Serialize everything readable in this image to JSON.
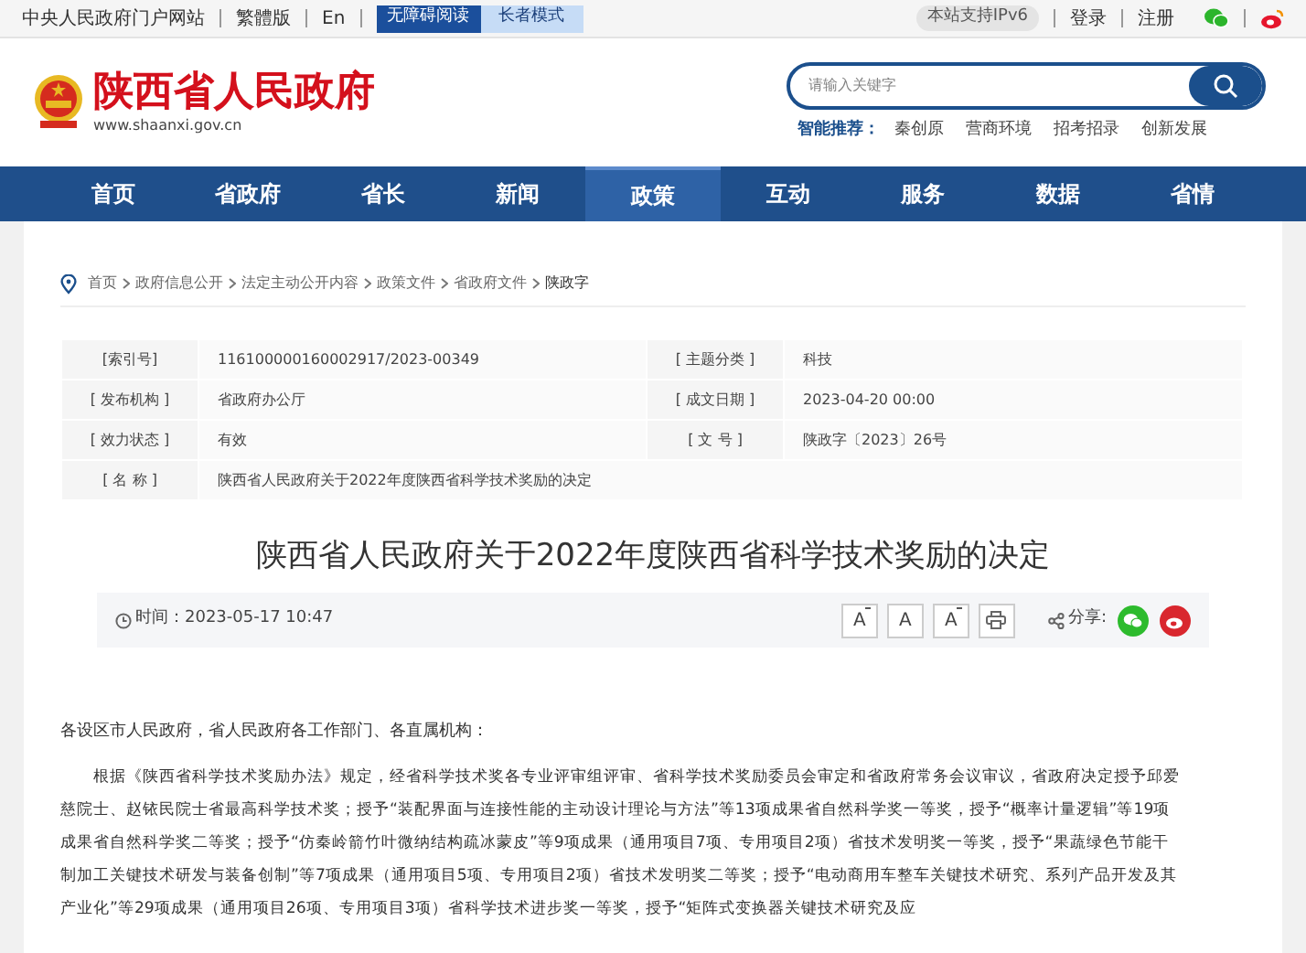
{
  "top_bar": {
    "links": [
      "中央人民政府门户网站",
      "繁體版",
      "En"
    ],
    "mode_buttons": [
      {
        "label": "无障碍阅读",
        "kind": "primary"
      },
      {
        "label": "长者模式",
        "kind": "secondary"
      }
    ],
    "ipv6_badge": "本站支持IPv6",
    "account_links": [
      "登录",
      "注册"
    ]
  },
  "header": {
    "site_title": "陕西省人民政府",
    "site_url": "www.shaanxi.gov.cn",
    "search": {
      "placeholder": "请输入关键字"
    },
    "recommend_label": "智能推荐：",
    "recommend_links": [
      "秦创原",
      "营商环境",
      "招考招录",
      "创新发展"
    ]
  },
  "nav": [
    {
      "label": "首页",
      "selected": false
    },
    {
      "label": "省政府",
      "selected": false
    },
    {
      "label": "省长",
      "selected": false
    },
    {
      "label": "新闻",
      "selected": false
    },
    {
      "label": "政策",
      "selected": true
    },
    {
      "label": "互动",
      "selected": false
    },
    {
      "label": "服务",
      "selected": false
    },
    {
      "label": "数据",
      "selected": false
    },
    {
      "label": "省情",
      "selected": false
    }
  ],
  "breadcrumb": [
    "首页",
    "政府信息公开",
    "法定主动公开内容",
    "政策文件",
    "省政府文件",
    "陕政字"
  ],
  "info_table": [
    [
      {
        "label": "[索引号]",
        "value": "116100000160002917/2023-00349"
      },
      {
        "label": "[ 主题分类 ]",
        "value": "科技"
      }
    ],
    [
      {
        "label": "[ 发布机构 ]",
        "value": "省政府办公厅"
      },
      {
        "label": "[ 成文日期 ]",
        "value": "2023-04-20 00:00"
      }
    ],
    [
      {
        "label": "[ 效力状态 ]",
        "value": "有效"
      },
      {
        "label": "[ 文 号 ]",
        "value": "陕政字〔2023〕26号"
      }
    ],
    [
      {
        "label": "[ 名 称 ]",
        "value": "陕西省人民政府关于2022年度陕西省科学技术奖励的决定"
      }
    ]
  ],
  "article": {
    "title": "陕西省人民政府关于2022年度陕西省科学技术奖励的决定",
    "time": "时间：2023-05-17 10:47",
    "font_buttons": [
      "A",
      "A",
      "A"
    ],
    "share_label": "分享:",
    "salutation": "各设区市人民政府，省人民政府各工作部门、各直属机构：",
    "paragraph": "根据《陕西省科学技术奖励办法》规定，经省科学技术奖各专业评审组评审、省科学技术奖励委员会审定和省政府常务会议审议，省政府决定授予邱爱慈院士、赵铱民院士省最高科学技术奖；授予“装配界面与连接性能的主动设计理论与方法”等13项成果省自然科学奖一等奖，授予“概率计量逻辑”等19项成果省自然科学奖二等奖；授予“仿秦岭箭竹叶微纳结构疏冰蒙皮”等9项成果（通用项目7项、专用项目2项）省技术发明奖一等奖，授予“果蔬绿色节能干制加工关键技术研发与装备创制”等7项成果（通用项目5项、专用项目2项）省技术发明奖二等奖；授予“电动商用车整车关键技术研究、系列产品开发及其产业化”等29项成果（通用项目26项、专用项目3项）省科学技术进步奖一等奖，授予“矩阵式变换器关键技术研究及应"
  }
}
